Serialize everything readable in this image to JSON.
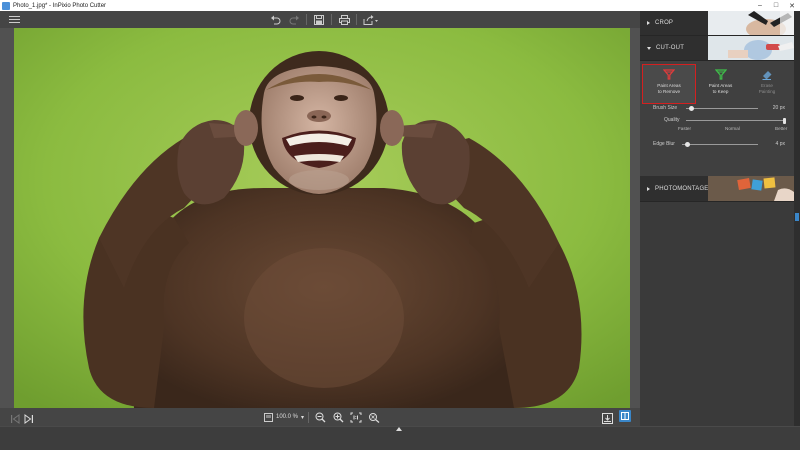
{
  "window": {
    "title": "Photo_1.jpg* - InPixio Photo Cutter",
    "controls": {
      "minimize": "–",
      "maximize": "□",
      "close": "✕"
    }
  },
  "toolbar": {
    "icons": [
      "menu-icon",
      "undo-icon",
      "redo-icon",
      "save-icon",
      "print-icon",
      "share-icon"
    ]
  },
  "bottom_bar": {
    "zoom_value": "100.0 %",
    "zoom_caret": "▾"
  },
  "panel": {
    "crop": {
      "label": "CROP"
    },
    "cutout": {
      "label": "CUT-OUT",
      "tools": [
        {
          "line1": "Paint Areas",
          "line2": "to Remove",
          "color": "#e23b3b",
          "active": true
        },
        {
          "line1": "Paint Areas",
          "line2": "to Keep",
          "color": "#3fbf4a",
          "active": false
        },
        {
          "line1": "Erase",
          "line2": "Painting",
          "color": "#6aa6d8",
          "active": false
        }
      ],
      "brush_size": {
        "label": "Brush Size",
        "value": "20 px",
        "level": 0.05
      },
      "quality": {
        "label": "Quality",
        "level": 1.0,
        "options": [
          "Faster",
          "Normal",
          "Better"
        ]
      },
      "edge_blur": {
        "label": "Edge Blur",
        "value": "4 px",
        "level": 0.04
      }
    },
    "photomontage": {
      "label": "PHOTOMONTAGE"
    }
  },
  "colors": {
    "accent": "#3a86c8",
    "highlight": "#d42020",
    "panel": "#3a3a3a"
  }
}
